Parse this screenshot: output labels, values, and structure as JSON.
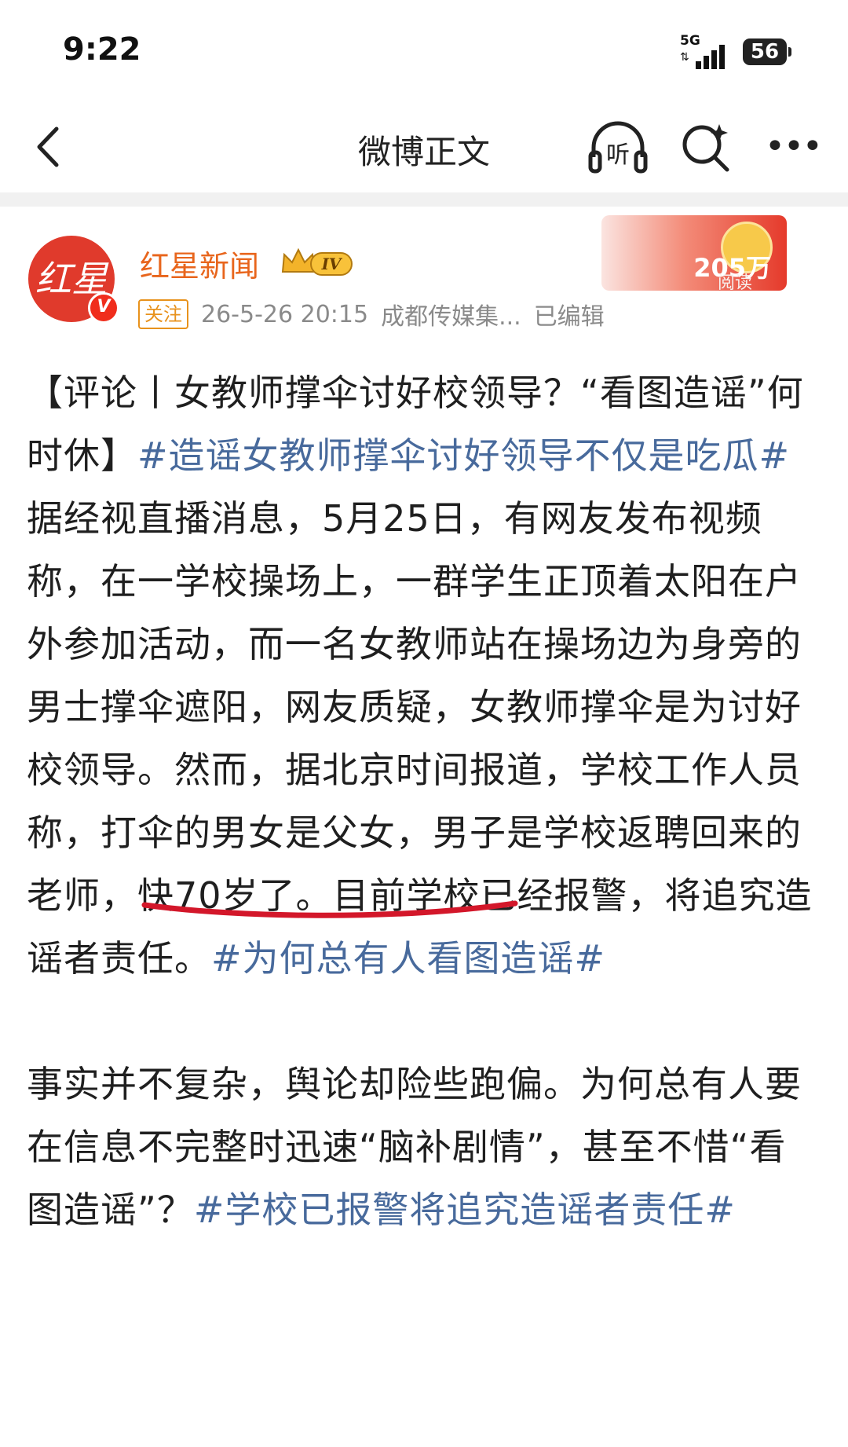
{
  "status_bar": {
    "time": "9:22",
    "network": "5G",
    "battery": "56"
  },
  "nav": {
    "title": "微博正文",
    "listen_label": "听"
  },
  "author": {
    "avatar_text": "红星",
    "verify_mark": "V",
    "name": "红星新闻",
    "level": "IV",
    "follow_label": "关注",
    "timestamp": "26-5-26 20:15",
    "source": "成都传媒集...",
    "edited": "已编辑",
    "read_count": "205万",
    "read_label": "阅读"
  },
  "post": {
    "para1": [
      {
        "t": "text",
        "v": "【评论丨女教师撑伞讨好校领导？“看图造谣”何时休】"
      },
      {
        "t": "tag",
        "v": "#造谣女教师撑伞讨好领导不仅是吃瓜#"
      },
      {
        "t": "text",
        "v": " 据经视直播消息，5月25日，有网友发布视频称，在一学校操场上，一群学生正顶着太阳在户外参加活动，而一名女教师站在操场边为身旁的男士撑伞遮阳，网友质疑，女教师撑伞是为讨好校领导。然而，据北京时间报道，学校工作人员称，打伞的男女是父女，男子是学校返聘回来的老师，快70岁了。目前学校已经报警，将追究造谣者责任。"
      },
      {
        "t": "tag",
        "v": "#为何总有人看图造谣#"
      }
    ],
    "para2": [
      {
        "t": "text",
        "v": "事实并不复杂，舆论却险些跑偏。为何总有人要在信息不完整时迅速“脑补剧情”，甚至不惜“看图造谣”？"
      },
      {
        "t": "tag",
        "v": "#学校已报警将追究造谣者责任#"
      }
    ]
  },
  "colors": {
    "hashtag": "#486a9c",
    "author": "#e8651c",
    "underline": "#d3172a"
  }
}
